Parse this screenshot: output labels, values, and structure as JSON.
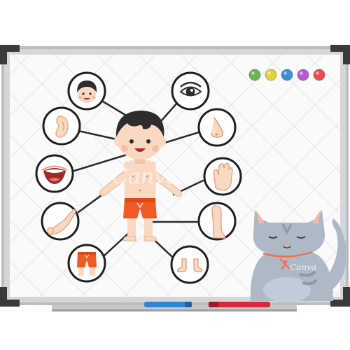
{
  "watermark": {
    "text": "Canva",
    "small_text": "Canva"
  },
  "colors": {
    "frame": "#b9bcc0",
    "frame_shadow": "#8c9095",
    "board": "#fafafa",
    "corner": "#3a3a3c",
    "line": "#2b2b2b",
    "skin": "#fbd8c2",
    "skin_shadow": "#f0b998",
    "hair": "#2d2d2d",
    "shorts": "#f05a24",
    "cat": "#aeb9c6",
    "cat_dark": "#8d99a8",
    "cat_nose": "#f7a07a",
    "collar": "#f26d52",
    "marker_blue": "#2f86d3",
    "marker_red": "#d8283a"
  },
  "magnets": [
    {
      "name": "green-magnet",
      "color": "#6bb454"
    },
    {
      "name": "yellow-magnet",
      "color": "#e2d23a"
    },
    {
      "name": "blue-magnet",
      "color": "#3d8fd6"
    },
    {
      "name": "purple-magnet",
      "color": "#b85ad6"
    },
    {
      "name": "red-magnet",
      "color": "#ea4a55"
    }
  ],
  "body_parts": [
    {
      "name": "head",
      "icon": "head-icon"
    },
    {
      "name": "eye",
      "icon": "eye-icon"
    },
    {
      "name": "ear",
      "icon": "ear-icon"
    },
    {
      "name": "nose",
      "icon": "nose-icon"
    },
    {
      "name": "mouth",
      "icon": "mouth-icon"
    },
    {
      "name": "hand",
      "icon": "hand-icon"
    },
    {
      "name": "arm",
      "icon": "arm-icon"
    },
    {
      "name": "leg",
      "icon": "leg-icon"
    },
    {
      "name": "hips",
      "icon": "shorts-icon"
    },
    {
      "name": "feet",
      "icon": "feet-icon"
    }
  ]
}
